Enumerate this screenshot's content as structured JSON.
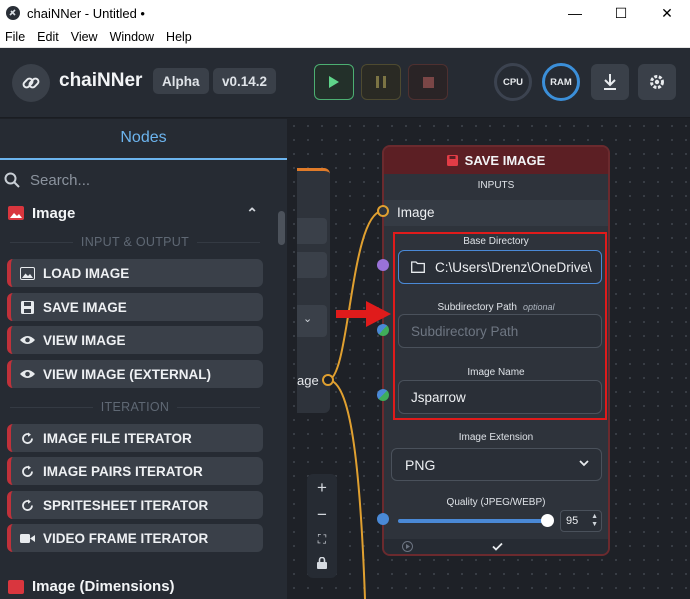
{
  "window": {
    "title": "chaiNNer - Untitled •",
    "minimize": "—",
    "maximize": "☐",
    "close": "✕"
  },
  "menu": [
    "File",
    "Edit",
    "View",
    "Window",
    "Help"
  ],
  "header": {
    "brand": "chaiNNer",
    "channel": "Alpha",
    "version": "v0.14.2",
    "cpu_label": "CPU",
    "ram_label": "RAM"
  },
  "sidebar": {
    "tab": "Nodes",
    "search_placeholder": "Search...",
    "category": "Image",
    "sections": {
      "io": "INPUT & OUTPUT",
      "iteration": "ITERATION"
    },
    "io_items": [
      {
        "label": "LOAD IMAGE",
        "icon": "image-icon"
      },
      {
        "label": "SAVE IMAGE",
        "icon": "floppy-icon"
      },
      {
        "label": "VIEW IMAGE",
        "icon": "eye-icon"
      },
      {
        "label": "VIEW IMAGE (EXTERNAL)",
        "icon": "eye-icon"
      }
    ],
    "iteration_items": [
      {
        "label": "IMAGE FILE ITERATOR",
        "icon": "loop-icon"
      },
      {
        "label": "IMAGE PAIRS ITERATOR",
        "icon": "loop-icon"
      },
      {
        "label": "SPRITESHEET ITERATOR",
        "icon": "loop-icon"
      },
      {
        "label": "VIDEO FRAME ITERATOR",
        "icon": "video-icon"
      }
    ],
    "next_category": "Image (Dimensions)"
  },
  "canvas": {
    "ghost_label": "age",
    "zoom": [
      "+",
      "−",
      "⛶",
      "🔒"
    ]
  },
  "save_node": {
    "title": "SAVE IMAGE",
    "inputs_label": "INPUTS",
    "image_input": "Image",
    "base_dir_label": "Base Directory",
    "base_dir_value": "C:\\Users\\Drenz\\OneDrive\\",
    "subdir_label": "Subdirectory Path",
    "subdir_optional": "optional",
    "subdir_placeholder": "Subdirectory Path",
    "image_name_label": "Image Name",
    "image_name_value": "Jsparrow",
    "ext_label": "Image Extension",
    "ext_value": "PNG",
    "quality_label": "Quality (JPEG/WEBP)",
    "quality_value": "95",
    "quality_fraction": 0.95
  },
  "colors": {
    "accent_blue": "#6cb4ee",
    "node_red": "#c0313a",
    "highlight_red": "#e01b1b",
    "connection_orange": "#e0a030",
    "play_green": "#4caf72"
  }
}
